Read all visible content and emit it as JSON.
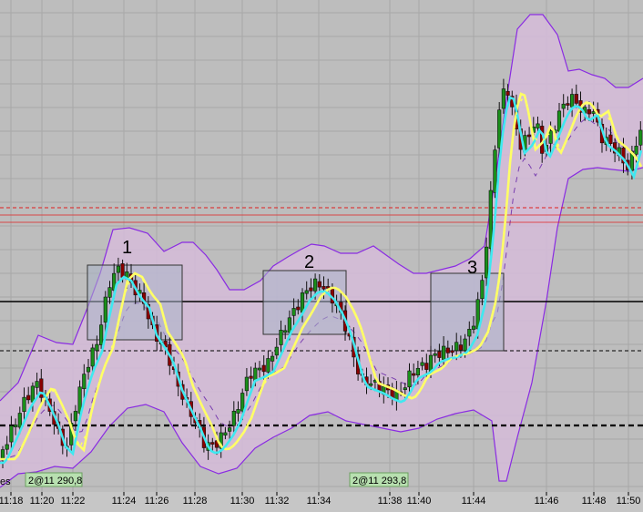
{
  "chart_data": {
    "type": "candlestick",
    "x_ticks": [
      "11:18",
      "11:20",
      "11:22",
      "11:24",
      "11:26",
      "11:28",
      "11:30",
      "11:32",
      "11:34",
      "11:38",
      "11:40",
      "11:44",
      "11:46",
      "11:48",
      "11:50"
    ],
    "edge_label": "es",
    "markers": [
      "1",
      "2",
      "3"
    ],
    "order_labels": [
      "2@11 290,8",
      "2@11 293,8"
    ],
    "colors": {
      "background": "#bdbdbd",
      "band_fill": "#d6bcd9",
      "band_line": "#8a2be2",
      "up_candle": "#1a8f1a",
      "down_candle": "#8b0000",
      "fast_line": "#40e8f0",
      "slow_line": "#ffff66",
      "box_fill": "#aab4c8",
      "dashed_red": "#e02020",
      "order_label_bg": "#b8e0b0"
    },
    "grid": true
  }
}
